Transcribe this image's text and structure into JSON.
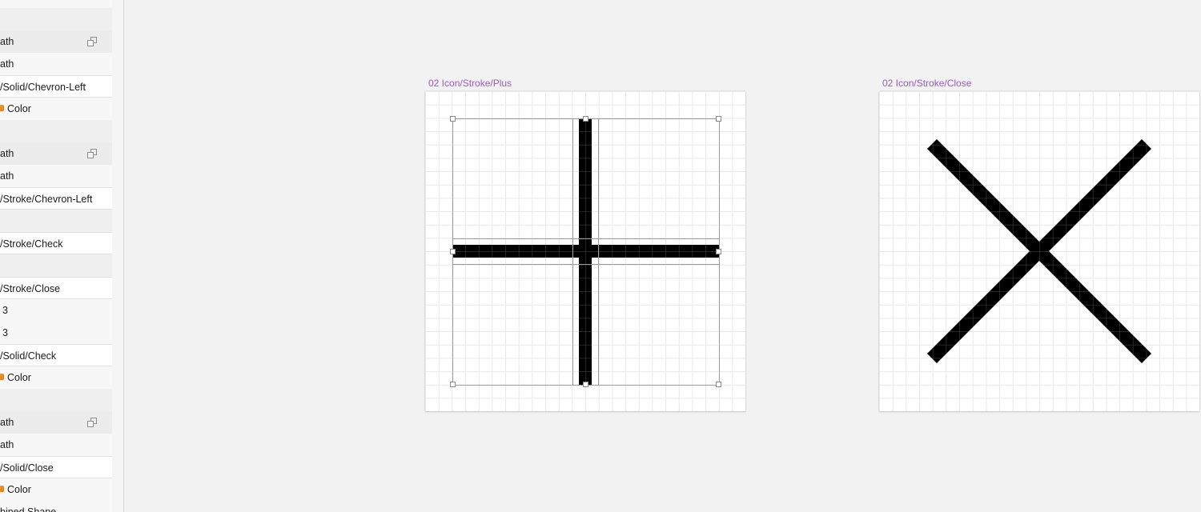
{
  "sidebar": {
    "rows": [
      {
        "kind": "blank",
        "text": ""
      },
      {
        "kind": "group",
        "text": "ath",
        "link_icon": true
      },
      {
        "kind": "plain",
        "text": "ath"
      },
      {
        "kind": "symbol",
        "text": "/Solid/Chevron-Left"
      },
      {
        "kind": "plain",
        "text": "Color",
        "badge": true
      },
      {
        "kind": "blank",
        "text": ""
      },
      {
        "kind": "group",
        "text": "ath",
        "link_icon": true
      },
      {
        "kind": "plain",
        "text": "ath"
      },
      {
        "kind": "symbol",
        "text": "/Stroke/Chevron-Left"
      },
      {
        "kind": "blank",
        "text": ""
      },
      {
        "kind": "symbol",
        "text": "/Stroke/Check"
      },
      {
        "kind": "blank",
        "text": ""
      },
      {
        "kind": "symbol",
        "text": "/Stroke/Close"
      },
      {
        "kind": "plain",
        "text": "3",
        "indent": true
      },
      {
        "kind": "plain",
        "text": "3",
        "indent": true
      },
      {
        "kind": "symbol",
        "text": "/Solid/Check"
      },
      {
        "kind": "plain",
        "text": "Color",
        "badge": true
      },
      {
        "kind": "blank",
        "text": ""
      },
      {
        "kind": "group",
        "text": "ath",
        "link_icon": true
      },
      {
        "kind": "plain",
        "text": "ath"
      },
      {
        "kind": "symbol",
        "text": "/Solid/Close"
      },
      {
        "kind": "plain",
        "text": "Color",
        "badge": true
      },
      {
        "kind": "plain",
        "text": "bined Shape"
      }
    ]
  },
  "canvas": {
    "artboards": [
      {
        "title": "02 Icon/Stroke/Plus",
        "icon": "plus-icon",
        "selected": true
      },
      {
        "title": "02 Icon/Stroke/Close",
        "icon": "close-icon",
        "selected": false
      }
    ]
  },
  "colors": {
    "artboard_title": "#9a5bc0",
    "icon_fill": "#000000",
    "pixel_grid": "#e9e9e9",
    "selection": "#9c9c9c"
  }
}
